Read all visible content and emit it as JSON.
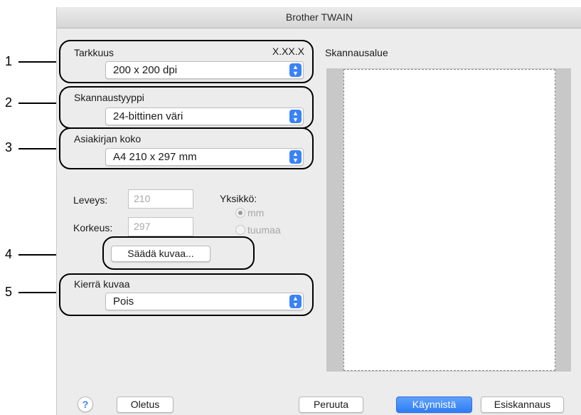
{
  "window": {
    "title": "Brother TWAIN"
  },
  "callouts": [
    "1",
    "2",
    "3",
    "4",
    "5"
  ],
  "resolution": {
    "label": "Tarkkuus",
    "version": "X.XX.X",
    "value": "200 x 200 dpi"
  },
  "scan_type": {
    "label": "Skannaustyyppi",
    "value": "24-bittinen väri"
  },
  "document_size": {
    "label": "Asiakirjan koko",
    "value": "A4  210 x 297 mm"
  },
  "dimensions": {
    "width_label": "Leveys:",
    "width_value": "210",
    "height_label": "Korkeus:",
    "height_value": "297",
    "unit_label": "Yksikkö:",
    "unit_options": [
      "mm",
      "tuumaa"
    ],
    "unit_selected": "mm"
  },
  "adjust_button": "Säädä kuvaa...",
  "rotate": {
    "label": "Kierrä kuvaa",
    "value": "Pois"
  },
  "scan_area": {
    "label": "Skannausalue"
  },
  "footer": {
    "help": "?",
    "default": "Oletus",
    "cancel": "Peruuta",
    "start": "Käynnistä",
    "prescan": "Esiskannaus"
  },
  "colors": {
    "accent": "#3a83f7",
    "window_bg": "#ececec",
    "preview_bg": "#c8c8c8"
  }
}
